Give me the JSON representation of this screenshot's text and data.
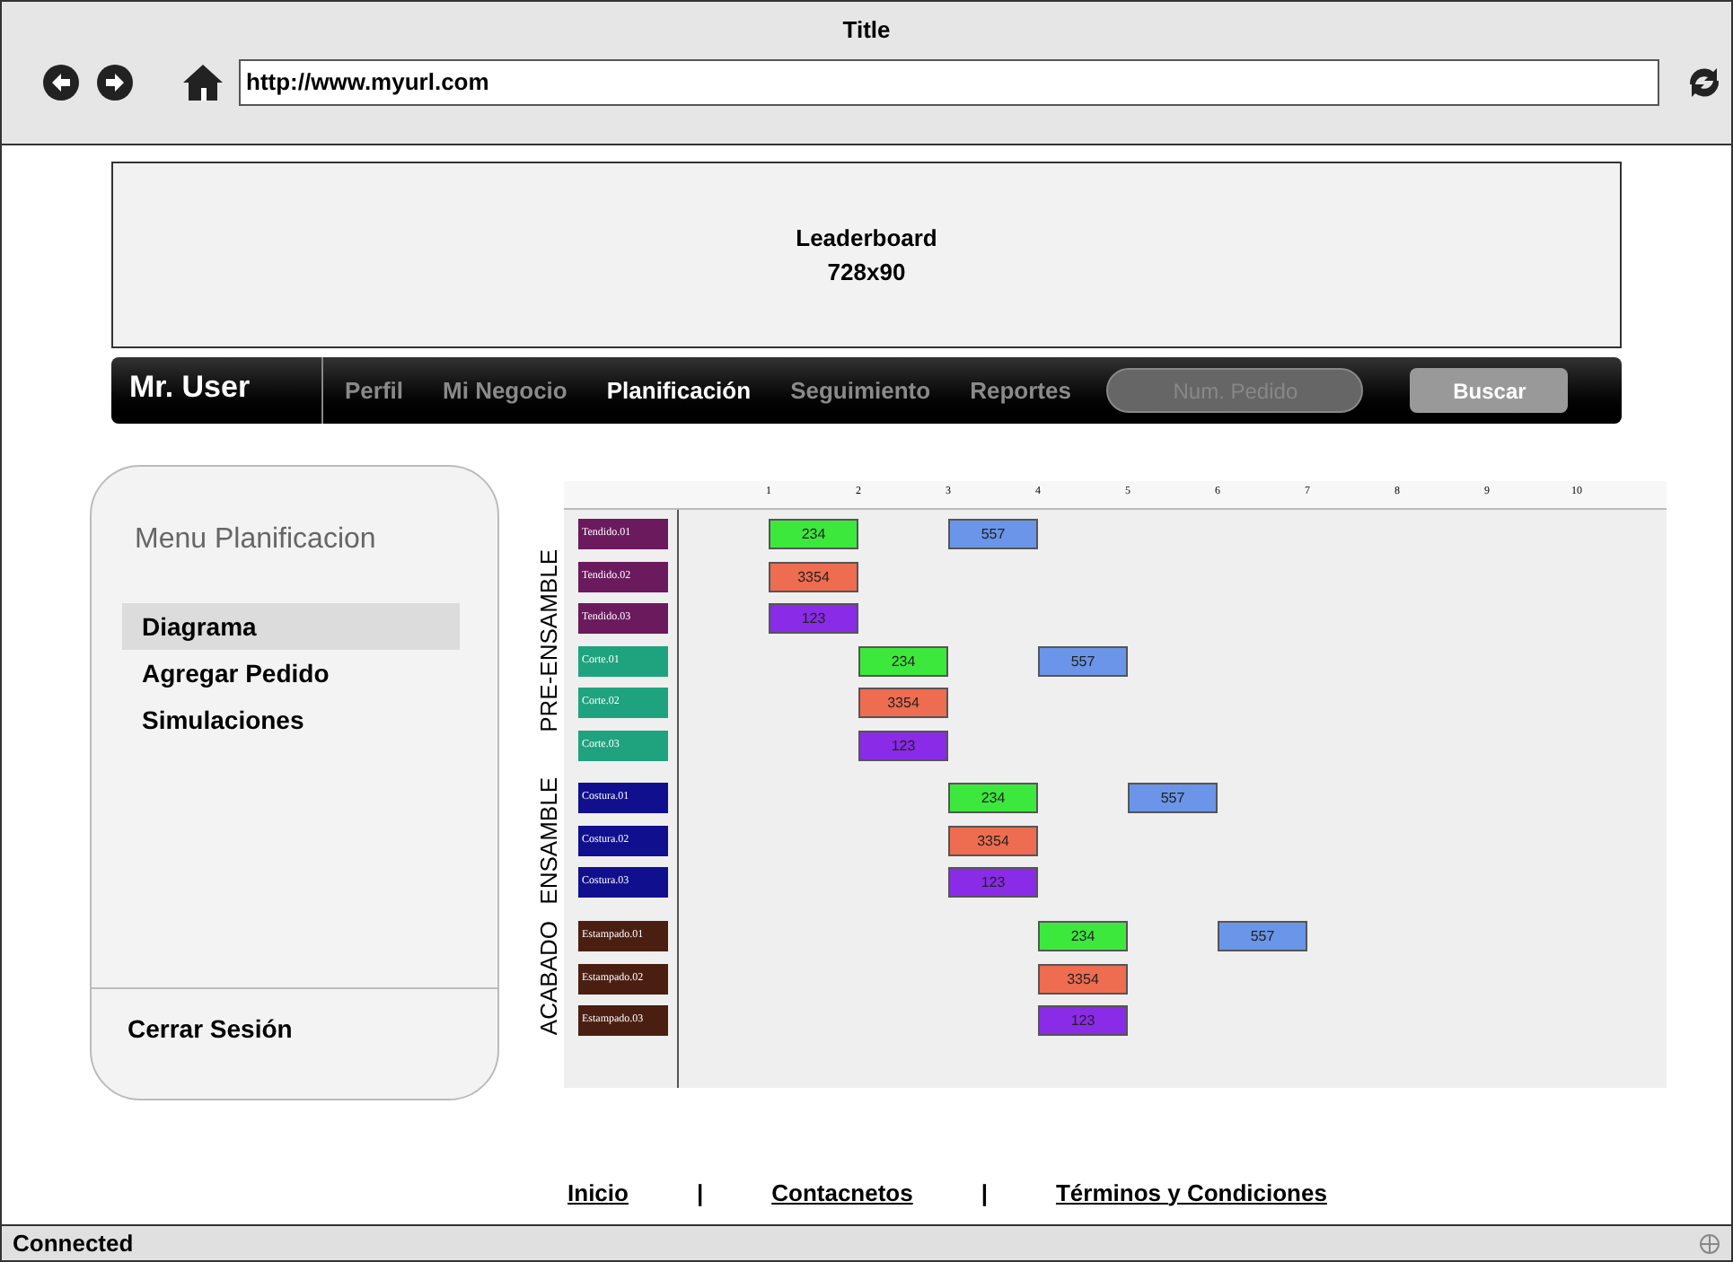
{
  "window": {
    "title": "Title",
    "url": "http://www.myurl.com"
  },
  "leaderboard": {
    "lines": [
      "Leaderboard",
      "728x90"
    ]
  },
  "navbar": {
    "user": "Mr. User",
    "items": [
      {
        "label": "Perfil",
        "selected": false
      },
      {
        "label": "Mi Negocio",
        "selected": false
      },
      {
        "label": "Planificación",
        "selected": true
      },
      {
        "label": "Seguimiento",
        "selected": false
      },
      {
        "label": "Reportes",
        "selected": false
      }
    ],
    "search": {
      "placeholder": "Num. Pedido"
    },
    "button": "Buscar"
  },
  "sidebar": {
    "title": "Menu Planificacion",
    "items": [
      {
        "label": "Diagrama",
        "selected": true
      },
      {
        "label": "Agregar Pedido",
        "selected": false
      },
      {
        "label": "Simulaciones",
        "selected": false
      }
    ],
    "logout": "Cerrar Sesión"
  },
  "gantt": {
    "ticks": [
      "1",
      "2",
      "3",
      "4",
      "5",
      "6",
      "7",
      "8",
      "9",
      "10"
    ],
    "groups": [
      {
        "label": "PRE-ENSAMBLE",
        "rows": [
          {
            "label": "Tendido.01",
            "color": "#6b1a5e",
            "slots": [
              {
                "kind": "gap"
              },
              {
                "kind": "task",
                "label": "234",
                "color": "#3de83d"
              },
              {
                "kind": "gap"
              },
              {
                "kind": "task",
                "label": "557",
                "color": "#6a95e8"
              }
            ]
          },
          {
            "label": "Tendido.02",
            "color": "#6b1a5e",
            "slots": [
              {
                "kind": "gap"
              },
              {
                "kind": "task",
                "label": "3354",
                "color": "#ee6c50"
              }
            ]
          },
          {
            "label": "Tendido.03",
            "color": "#6b1a5e",
            "slots": [
              {
                "kind": "gap"
              },
              {
                "kind": "task",
                "label": "123",
                "color": "#8a2be8"
              }
            ]
          },
          {
            "label": "Corte.01",
            "color": "#1fa37e",
            "slots": [
              {
                "kind": "gap"
              },
              {
                "kind": "gap"
              },
              {
                "kind": "task",
                "label": "234",
                "color": "#3de83d"
              },
              {
                "kind": "gap"
              },
              {
                "kind": "task",
                "label": "557",
                "color": "#6a95e8"
              }
            ]
          },
          {
            "label": "Corte.02",
            "color": "#1fa37e",
            "slots": [
              {
                "kind": "gap"
              },
              {
                "kind": "gap"
              },
              {
                "kind": "task",
                "label": "3354",
                "color": "#ee6c50"
              }
            ]
          },
          {
            "label": "Corte.03",
            "color": "#1fa37e",
            "slots": [
              {
                "kind": "gap"
              },
              {
                "kind": "gap"
              },
              {
                "kind": "task",
                "label": "123",
                "color": "#8a2be8"
              }
            ]
          }
        ]
      },
      {
        "label": "ENSAMBLE",
        "rows": [
          {
            "label": "Costura.01",
            "color": "#10108f",
            "slots": [
              {
                "kind": "gap"
              },
              {
                "kind": "gap"
              },
              {
                "kind": "gap"
              },
              {
                "kind": "task",
                "label": "234",
                "color": "#3de83d"
              },
              {
                "kind": "gap"
              },
              {
                "kind": "task",
                "label": "557",
                "color": "#6a95e8"
              }
            ]
          },
          {
            "label": "Costura.02",
            "color": "#10108f",
            "slots": [
              {
                "kind": "gap"
              },
              {
                "kind": "gap"
              },
              {
                "kind": "gap"
              },
              {
                "kind": "task",
                "label": "3354",
                "color": "#ee6c50"
              }
            ]
          },
          {
            "label": "Costura.03",
            "color": "#10108f",
            "slots": [
              {
                "kind": "gap"
              },
              {
                "kind": "gap"
              },
              {
                "kind": "gap"
              },
              {
                "kind": "task",
                "label": "123",
                "color": "#8a2be8"
              }
            ]
          }
        ]
      },
      {
        "label": "ACABADO",
        "rows": [
          {
            "label": "Estampado.01",
            "color": "#4a1f12",
            "slots": [
              {
                "kind": "gap"
              },
              {
                "kind": "gap"
              },
              {
                "kind": "gap"
              },
              {
                "kind": "gap"
              },
              {
                "kind": "task",
                "label": "234",
                "color": "#3de83d"
              },
              {
                "kind": "gap"
              },
              {
                "kind": "task",
                "label": "557",
                "color": "#6a95e8"
              }
            ]
          },
          {
            "label": "Estampado.02",
            "color": "#4a1f12",
            "slots": [
              {
                "kind": "gap"
              },
              {
                "kind": "gap"
              },
              {
                "kind": "gap"
              },
              {
                "kind": "gap"
              },
              {
                "kind": "task",
                "label": "3354",
                "color": "#ee6c50"
              }
            ]
          },
          {
            "label": "Estampado.03",
            "color": "#4a1f12",
            "slots": [
              {
                "kind": "gap"
              },
              {
                "kind": "gap"
              },
              {
                "kind": "gap"
              },
              {
                "kind": "gap"
              },
              {
                "kind": "task",
                "label": "123",
                "color": "#8a2be8"
              }
            ]
          }
        ]
      }
    ]
  },
  "footer": {
    "links": [
      "Inicio",
      "Contacnetos",
      "Términos y Condiciones"
    ],
    "separator": "|"
  },
  "status_bar": {
    "text": "Connected"
  }
}
